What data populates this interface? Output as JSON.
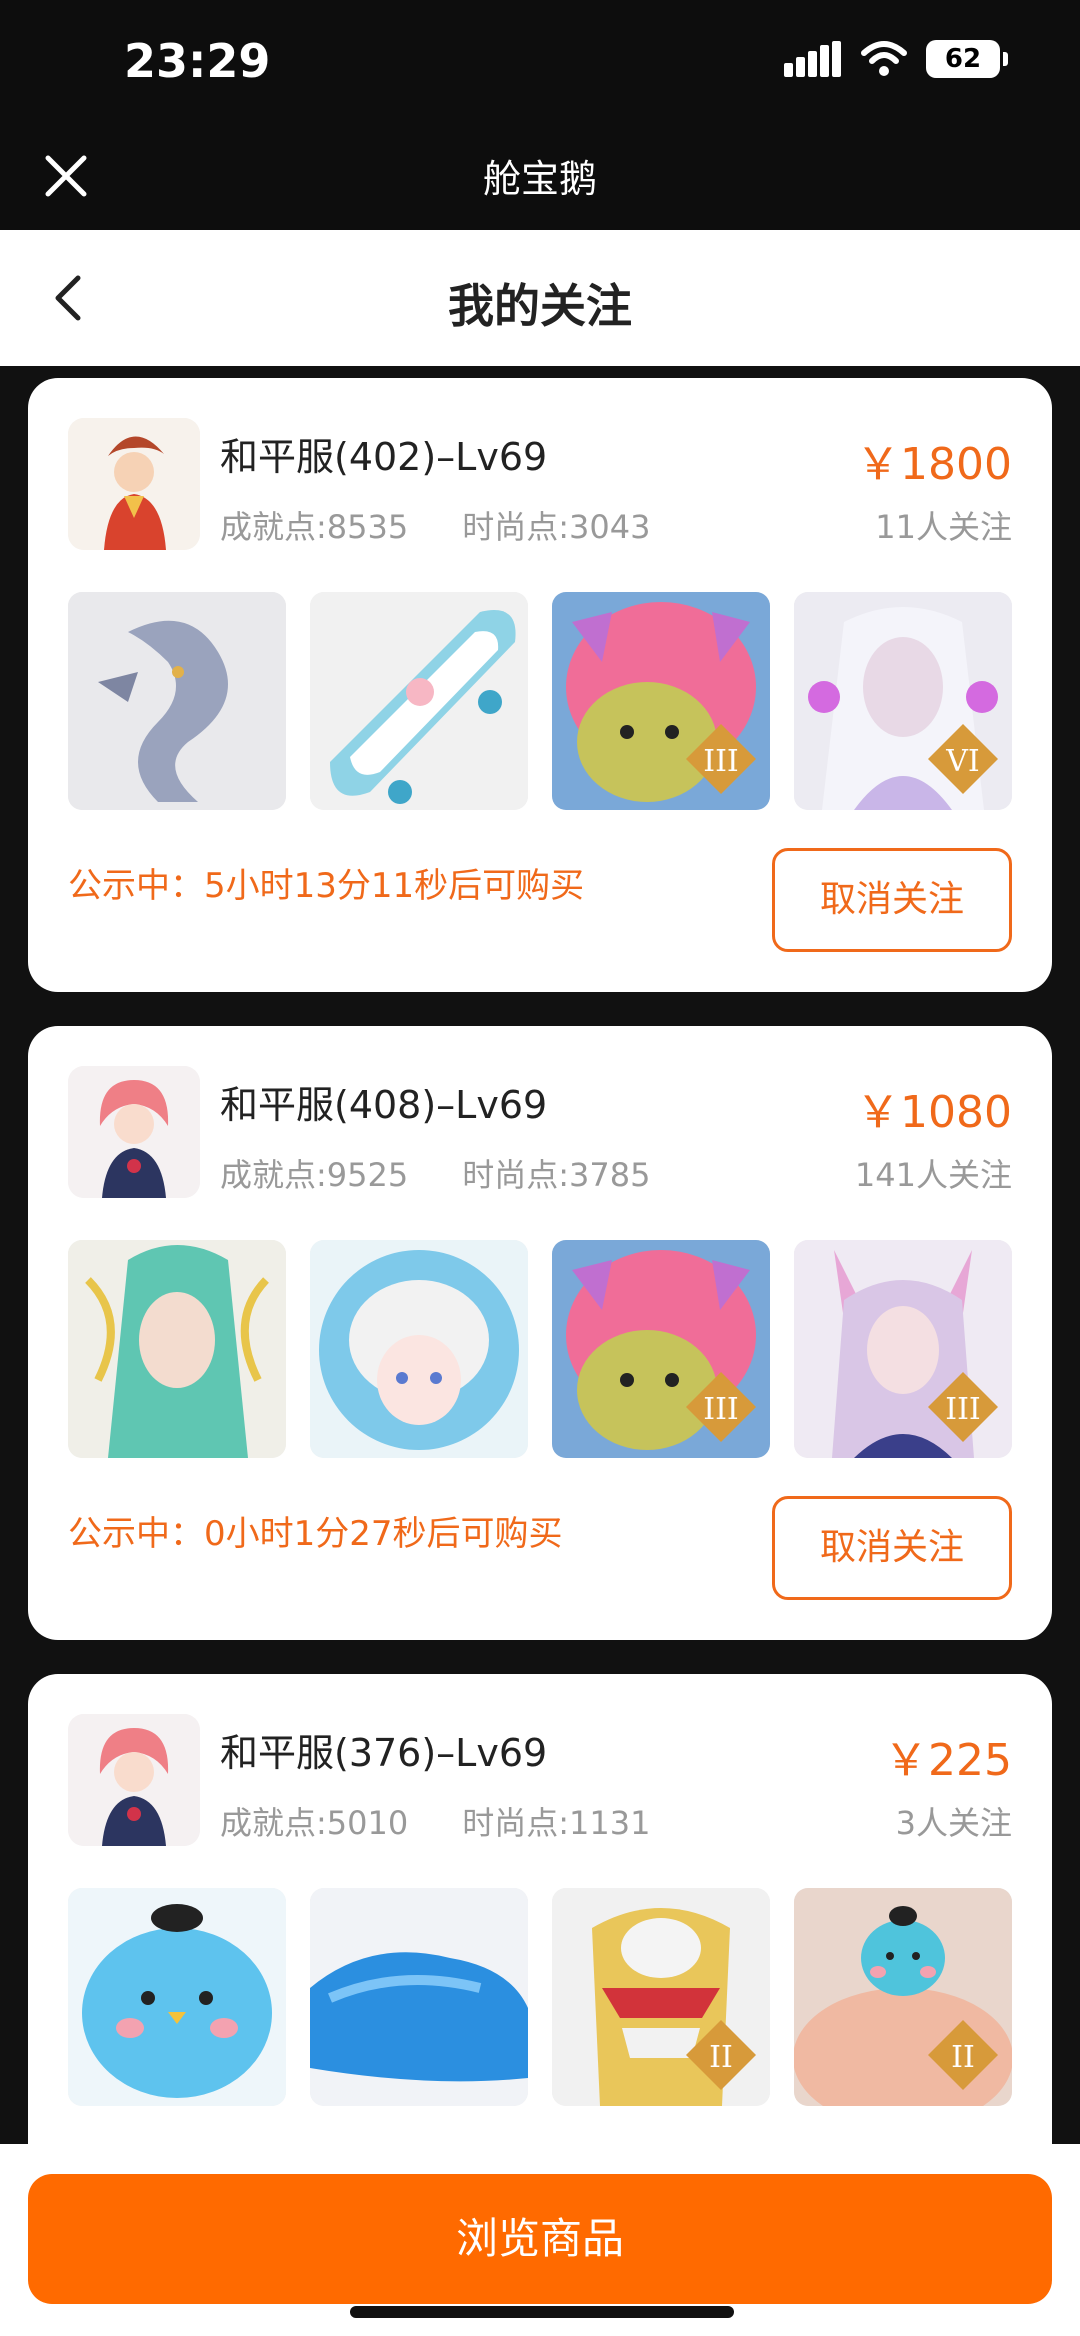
{
  "status": {
    "time": "23:29",
    "battery": "62"
  },
  "app": {
    "title": "舱宝鹅"
  },
  "nav": {
    "title": "我的关注"
  },
  "cards": [
    {
      "server": "和平服(402)–Lv69",
      "achievement": "成就点:8535",
      "fashion": "时尚点:3043",
      "price": "￥1800",
      "followers": "11人关注",
      "notice": "公示中：5小时13分11秒后可购买",
      "action": "取消关注"
    },
    {
      "server": "和平服(408)–Lv69",
      "achievement": "成就点:9525",
      "fashion": "时尚点:3785",
      "price": "￥1080",
      "followers": "141人关注",
      "notice": "公示中：0小时1分27秒后可购买",
      "action": "取消关注"
    },
    {
      "server": "和平服(376)–Lv69",
      "achievement": "成就点:5010",
      "fashion": "时尚点:1131",
      "price": "￥225",
      "followers": "3人关注"
    }
  ],
  "bottom": {
    "browse_label": "浏览商品"
  },
  "colors": {
    "accent": "#f0691a",
    "button": "#ff6a00"
  }
}
